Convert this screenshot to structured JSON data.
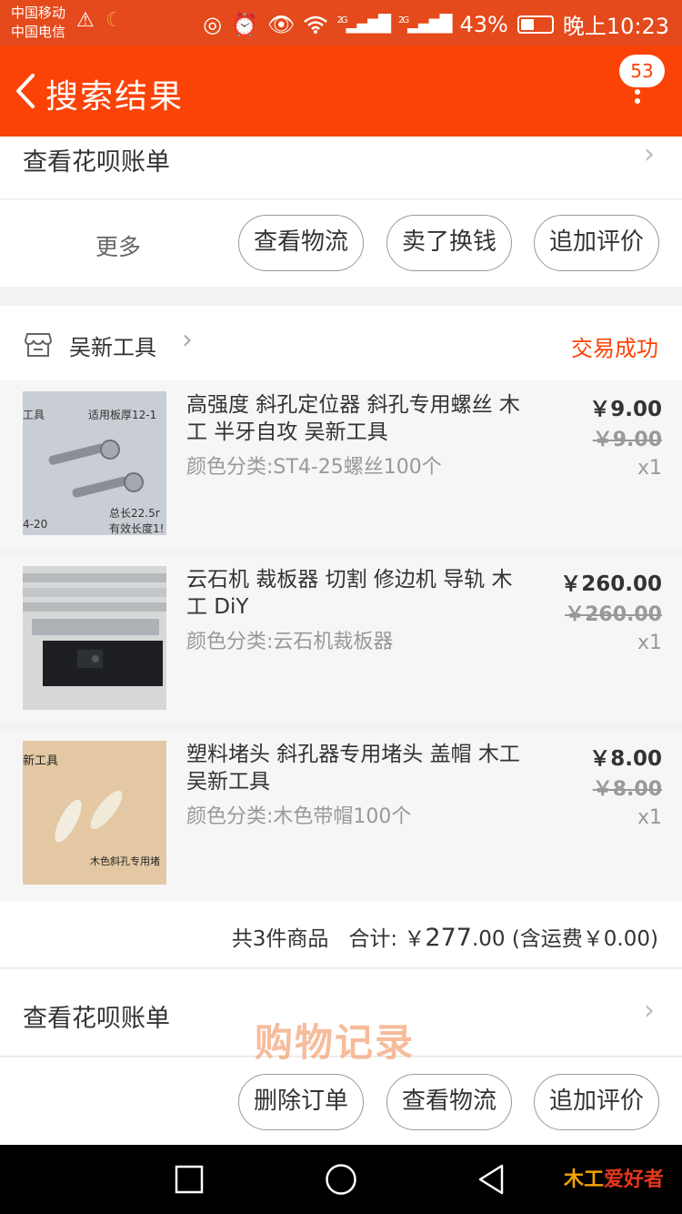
{
  "status": {
    "carrier1": "中国移动",
    "carrier2": "中国电信",
    "signal_a": "2G",
    "signal_b": "2G",
    "battery": "43%",
    "battery_level": 0.43,
    "time": "晚上10:23"
  },
  "nav": {
    "title": "搜索结果",
    "badge": "53"
  },
  "top_row": {
    "huabei": "查看花呗账单",
    "more": "更多",
    "buttons": [
      "查看物流",
      "卖了换钱",
      "追加评价"
    ]
  },
  "order": {
    "shop": "吴新工具",
    "status": "交易成功",
    "items": [
      {
        "title": "高强度 斜孔定位器 斜孔专用螺丝 木工 半牙自攻 吴新工具",
        "spec": "颜色分类:ST4-25螺丝100个",
        "price": "￥9.00",
        "orig": "￥9.00",
        "qty": "x1",
        "thumb_text": [
          "工具",
          "适用板厚12-1",
          "总长22.5r",
          "有效长度1!",
          "4-20"
        ]
      },
      {
        "title": "云石机 裁板器 切割 修边机 导轨 木工 DiY",
        "spec": "颜色分类:云石机裁板器",
        "price": "￥260.00",
        "orig": "￥260.00",
        "qty": "x1",
        "thumb_text": []
      },
      {
        "title": "塑料堵头 斜孔器专用堵头 盖帽 木工 吴新工具",
        "spec": "颜色分类:木色带帽100个",
        "price": "￥8.00",
        "orig": "￥8.00",
        "qty": "x1",
        "thumb_text": [
          "新工具",
          "木色斜孔专用堵"
        ]
      }
    ],
    "summary": {
      "count": "共3件商品",
      "total_label": "合计: ￥",
      "total_int": "277",
      "total_dec": ".00",
      "shipping": "(含运费￥0.00)"
    },
    "huabei": "查看花呗账单",
    "buttons": [
      "删除订单",
      "查看物流",
      "追加评价"
    ]
  },
  "watermark": "购物记录",
  "logo": {
    "part1": "木工",
    "part2": "爱好者"
  }
}
